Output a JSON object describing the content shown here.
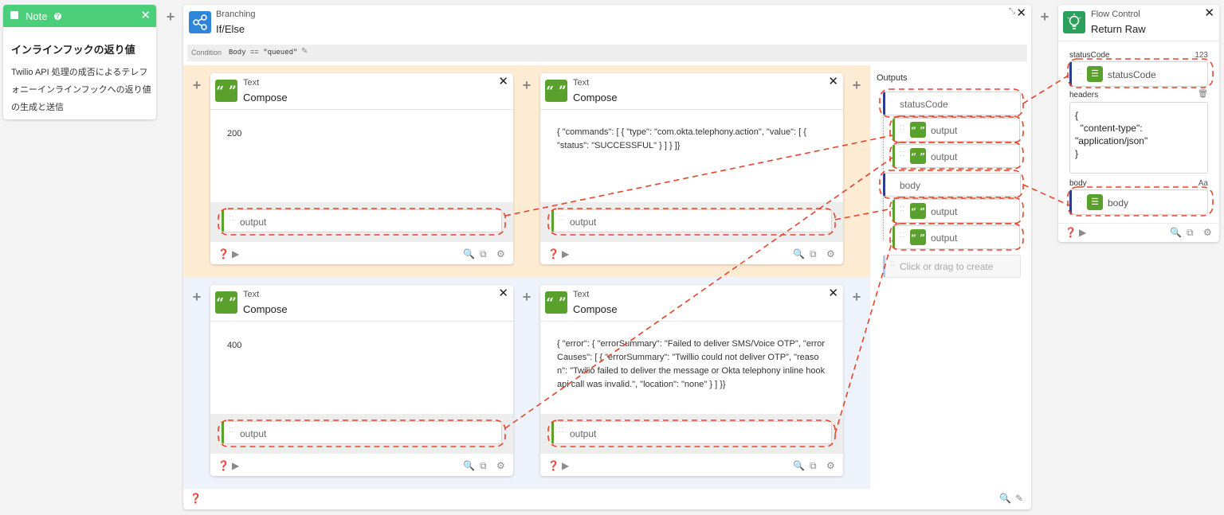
{
  "note": {
    "header_label": "Note",
    "title": "インラインフックの返り値",
    "body": "Twilio API 処理の成否によるテレフォニーインラインフックへの返り値の生成と送信",
    "accent": "#4ccf7a"
  },
  "branching": {
    "category": "Branching",
    "title": "If/Else",
    "condition_label": "Condition",
    "condition_value": "Body == \"queued\"",
    "outputs_label": "Outputs",
    "accent": "#2f86d8",
    "cards": [
      {
        "category": "Text",
        "title": "Compose",
        "content": "200",
        "output_label": "output"
      },
      {
        "category": "Text",
        "title": "Compose",
        "content": "{ \"commands\": [ { \"type\": \"com.okta.telephony.action\", \"value\": [ { \"status\": \"SUCCESSFUL\" } ] } ]}",
        "output_label": "output"
      },
      {
        "category": "Text",
        "title": "Compose",
        "content": "400",
        "output_label": "output"
      },
      {
        "category": "Text",
        "title": "Compose",
        "content": "{ \"error\": { \"errorSummary\": \"Failed to deliver SMS/Voice OTP\", \"errorCauses\": [ { \"errorSummary\": \"Twillio could not deliver OTP\", \"reason\": \"Twilio failed to deliver the message or Okta telephony inline hook api call was invalid.\", \"location\": \"none\" } ] }}",
        "output_label": "output"
      }
    ],
    "outputs": {
      "status_code_label": "statusCode",
      "output_label": "output",
      "body_label": "body",
      "create_placeholder": "Click or drag to create"
    }
  },
  "flow_control": {
    "category": "Flow Control",
    "title": "Return Raw",
    "accent": "#2aa05a",
    "status_code_field": "statusCode",
    "status_code_type": "123",
    "status_code_value": "statusCode",
    "headers_field": "headers",
    "headers_value": "{\n  \"content-type\":\n\"application/json\"\n}",
    "body_field": "body",
    "body_type": "Aa",
    "body_value": "body"
  },
  "colors": {
    "orange_band": "#fdebd3",
    "blue_band": "#eef2fb",
    "connector": "#e8432b",
    "green_icon": "#5aa02c"
  }
}
